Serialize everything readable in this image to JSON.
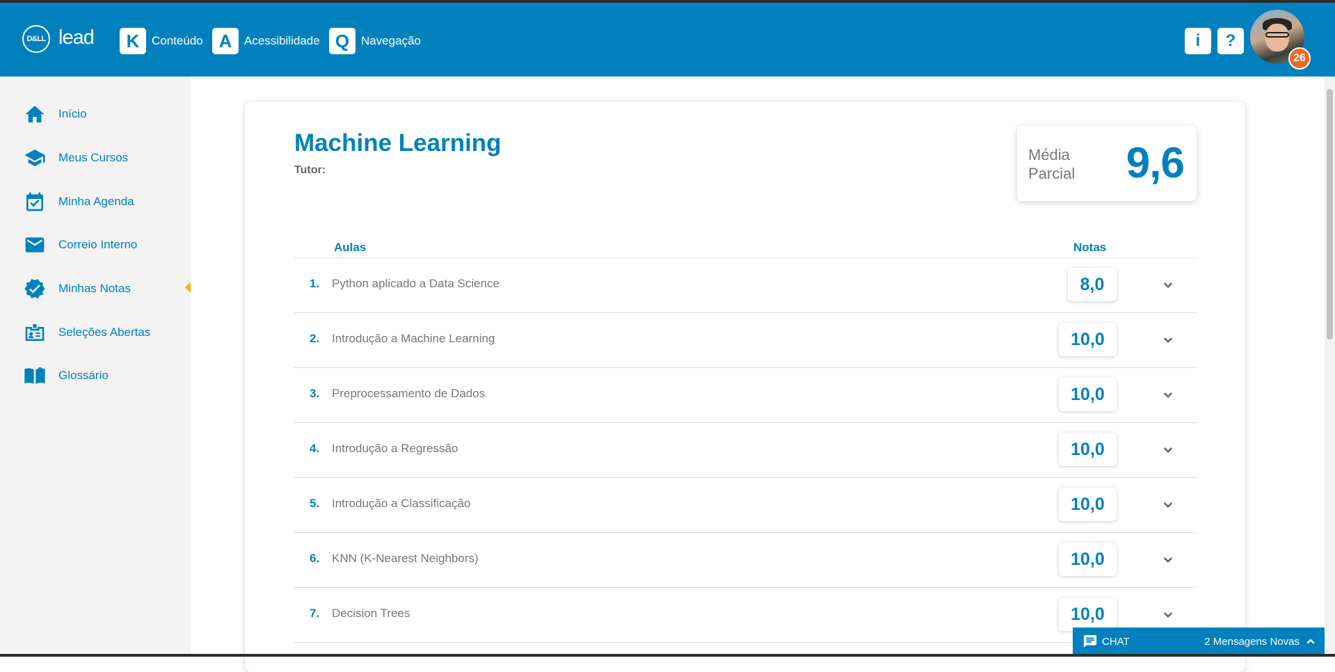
{
  "header": {
    "logo_dell": "D&LL",
    "logo_lead": "lead",
    "shortcuts": [
      {
        "key": "K",
        "label": "Conteúdo"
      },
      {
        "key": "A",
        "label": "Acessibilidade"
      },
      {
        "key": "Q",
        "label": "Navegação"
      }
    ],
    "info_button": "i",
    "help_button": "?",
    "notification_count": "26"
  },
  "sidebar": {
    "items": [
      {
        "label": "Início",
        "icon": "home-icon"
      },
      {
        "label": "Meus Cursos",
        "icon": "graduation-cap-icon"
      },
      {
        "label": "Minha Agenda",
        "icon": "calendar-check-icon"
      },
      {
        "label": "Correio Interno",
        "icon": "envelope-icon"
      },
      {
        "label": "Minhas Notas",
        "icon": "badge-check-icon",
        "active": true
      },
      {
        "label": "Seleções Abertas",
        "icon": "id-card-icon"
      },
      {
        "label": "Glossário",
        "icon": "book-icon"
      }
    ]
  },
  "course": {
    "title": "Machine Learning",
    "tutor_label": "Tutor:",
    "average_label": "Média Parcial",
    "average_value": "9,6"
  },
  "table": {
    "col_lessons": "Aulas",
    "col_grades": "Notas",
    "rows": [
      {
        "num": "1.",
        "title": "Python aplicado a Data Science",
        "grade": "8,0"
      },
      {
        "num": "2.",
        "title": "Introdução a Machine Learning",
        "grade": "10,0"
      },
      {
        "num": "3.",
        "title": "Preprocessamento de Dados",
        "grade": "10,0"
      },
      {
        "num": "4.",
        "title": "Introdução a Regressão",
        "grade": "10,0"
      },
      {
        "num": "5.",
        "title": "Introdução a Classificação",
        "grade": "10,0"
      },
      {
        "num": "6.",
        "title": "KNN (K-Nearest Neighbors)",
        "grade": "10,0"
      },
      {
        "num": "7.",
        "title": "Decision Trees",
        "grade": "10,0"
      }
    ]
  },
  "chat": {
    "label": "CHAT",
    "new_messages": "2 Mensagens Novas"
  },
  "colors": {
    "brand_blue": "#0081bd",
    "accent_yellow": "#f5b800",
    "badge_orange": "#f26a21"
  }
}
